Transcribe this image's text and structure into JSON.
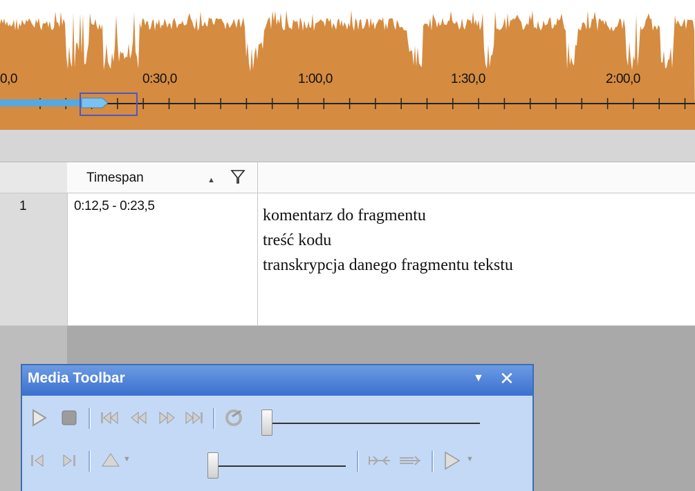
{
  "waveform": {
    "timeline_labels": [
      "0,0",
      "0:30,0",
      "1:00,0",
      "1:30,0",
      "2:00,0"
    ],
    "wave_color": "#d58b40",
    "selection_color": "#4c56c8"
  },
  "grid": {
    "columns": [
      "Timespan",
      ""
    ],
    "rows": [
      {
        "number": "1",
        "timespan": "0:12,5 - 0:23,5",
        "lines": [
          "komentarz do fragmentu",
          "treść kodu",
          "transkrypcja danego fragmentu tekstu"
        ]
      }
    ]
  },
  "media_toolbar": {
    "title": "Media Toolbar",
    "icons_row1": [
      "play-icon",
      "stop-icon",
      "skip-start-icon",
      "rewind-icon",
      "fast-forward-icon",
      "skip-end-icon",
      "loop-icon",
      "position-slider"
    ],
    "icons_row2": [
      "mark-start-icon",
      "mark-end-icon",
      "volume-icon",
      "volume-slider",
      "shrink-icon",
      "extend-icon",
      "play-options-icon"
    ],
    "accent": "#3c6db3"
  }
}
